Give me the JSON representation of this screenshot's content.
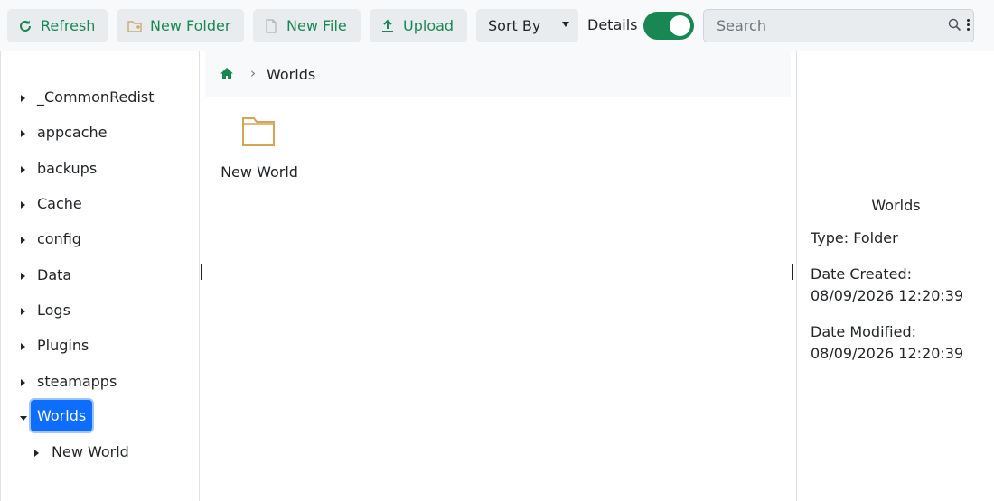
{
  "toolbar": {
    "refresh_label": "Refresh",
    "new_folder_label": "New Folder",
    "new_file_label": "New File",
    "upload_label": "Upload",
    "sort_by_label": "Sort By",
    "details_label": "Details",
    "details_enabled": true,
    "search_placeholder": "Search",
    "accent_color": "#198754"
  },
  "tree": {
    "items": [
      {
        "label": "_CommonRedist",
        "expanded": false
      },
      {
        "label": "appcache",
        "expanded": false
      },
      {
        "label": "backups",
        "expanded": false
      },
      {
        "label": "Cache",
        "expanded": false
      },
      {
        "label": "config",
        "expanded": false
      },
      {
        "label": "Data",
        "expanded": false
      },
      {
        "label": "Logs",
        "expanded": false
      },
      {
        "label": "Plugins",
        "expanded": false
      },
      {
        "label": "steamapps",
        "expanded": false
      },
      {
        "label": "Worlds",
        "expanded": true,
        "selected": true
      },
      {
        "label": "New World",
        "expanded": false,
        "child_of": "Worlds"
      }
    ],
    "selected_color": "#0d6efd"
  },
  "breadcrumb": {
    "home_icon": "home-icon",
    "current": "Worlds"
  },
  "files": [
    {
      "name": "New World",
      "icon": "folder-icon"
    }
  ],
  "details": {
    "title": "Worlds",
    "type_line": "Type: Folder",
    "created_label": "Date Created:",
    "created_value": "08/09/2026 12:20:39",
    "modified_label": "Date Modified:",
    "modified_value": "08/09/2026 12:20:39"
  }
}
